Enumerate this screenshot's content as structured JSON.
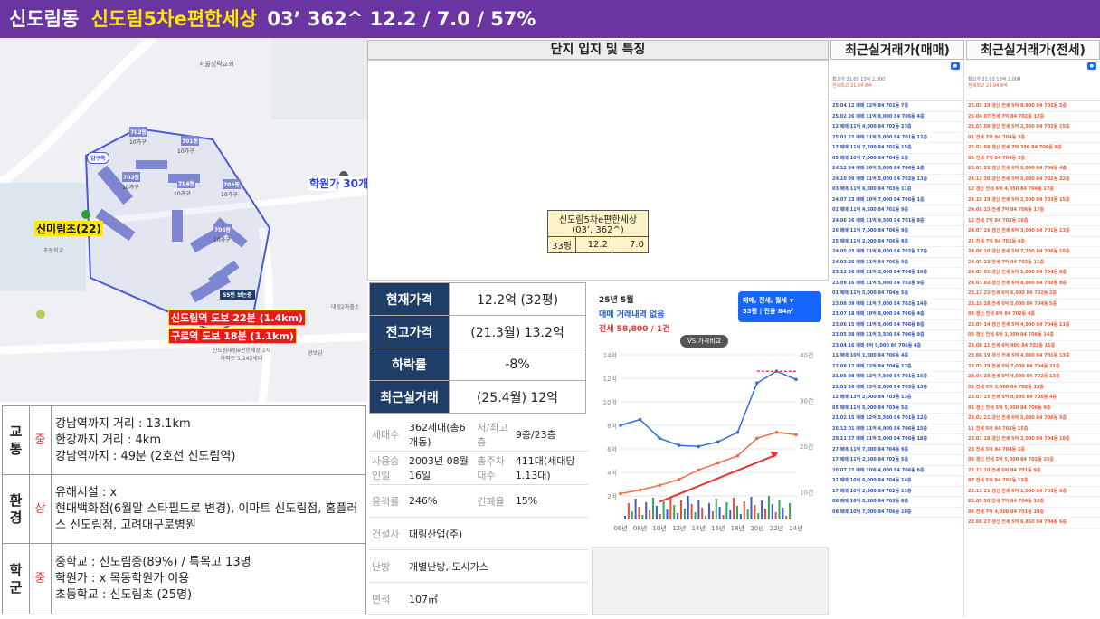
{
  "header": {
    "dong": "신도림동",
    "complex": "신도림5차e편한세상",
    "year_units": "03’ 362^",
    "prices": "12.2 / 7.0 / 57%"
  },
  "map": {
    "labels": {
      "school": "신미림초(22)",
      "academy": "학원가 30개",
      "station1": "신도림역 도보 22분 (1.4km)",
      "station2": "구로역 도보 18분 (1.1km)",
      "bus": "55번 보는중",
      "entrance": "입구쪽",
      "elementary": "초등학교",
      "seoul_church": "서울성락교회",
      "bldgs": [
        {
          "name": "702동",
          "sub": "10가구"
        },
        {
          "name": "701동",
          "sub": "10가구"
        },
        {
          "name": "703동",
          "sub": "10가구"
        },
        {
          "name": "704동",
          "sub": "10가구"
        },
        {
          "name": "705동",
          "sub": "10가구"
        },
        {
          "name": "706동",
          "sub": "10가구"
        }
      ],
      "complex_name": "신도림대림e편한세상 2차아파트 1,242세대",
      "daerim_ps": "대림2파출소",
      "gyeongbo": "경보당"
    }
  },
  "location_section": {
    "title": "단지 입지 및 특징",
    "info_table": {
      "name": "신도림5차e편한세상",
      "sub": "(03’, 362^)",
      "pyeong": "33평",
      "sale": "12.2",
      "jeonse": "7.0"
    }
  },
  "price_table": [
    {
      "key": "현재가격",
      "value": "12.2억 (32평)"
    },
    {
      "key": "전고가격",
      "value": "(21.3월) 13.2억"
    },
    {
      "key": "하락률",
      "value": "-8%"
    },
    {
      "key": "최근실거래",
      "value": "(25.4월) 12억"
    }
  ],
  "details": [
    [
      "세대수",
      "362세대(총6개동)",
      "저/최고층",
      "9층/23층"
    ],
    [
      "사용승인일",
      "2003년 08월 16일",
      "총주차대수",
      "411대(세대당 1.13대)"
    ],
    [
      "용적률",
      "246%",
      "건폐율",
      "15%"
    ],
    [
      "건설사",
      "대림산업(주)",
      "",
      ""
    ],
    [
      "난방",
      "개별난방, 도시가스",
      "",
      ""
    ],
    [
      "면적",
      "107㎡",
      "",
      ""
    ]
  ],
  "chart": {
    "month": "25년 5월",
    "status": "매매 거래내역 없음",
    "jeonse": "전세 58,800 / 1건",
    "tag_line1": "매매, 전세, 월세 ∨",
    "tag_line2": "33평 | 전용 84㎡",
    "vs_label": "VS 가격비교"
  },
  "chart_data": {
    "type": "line",
    "x": [
      "06년",
      "08년",
      "10년",
      "12년",
      "14년",
      "16년",
      "18년",
      "20년",
      "22년",
      "24년"
    ],
    "series": [
      {
        "values": [
          8,
          8.5,
          6.9,
          6.3,
          6.2,
          6.6,
          7.4,
          11.6,
          12.6,
          11.9
        ]
      },
      {
        "values": [
          2.2,
          2.5,
          2.9,
          3.4,
          4.2,
          4.8,
          5.4,
          6.9,
          7.4,
          7.2
        ]
      }
    ],
    "ylim": [
      0,
      14
    ],
    "yticks": [
      "14억",
      "12억",
      "10억",
      "8억",
      "6억",
      "4억",
      "2억"
    ],
    "y2ticks": [
      "40건",
      "30건",
      "20건",
      "10건"
    ],
    "grid": true
  },
  "left_info": [
    {
      "cat": "교통",
      "rating": "중",
      "lines": [
        "강남역까지 거리 : 13.1km",
        "한강까지 거리 : 4km",
        "강남역까지 : 49분 (2호선 신도림역)"
      ]
    },
    {
      "cat": "환경",
      "rating": "상",
      "lines": [
        "유해시설 : x",
        "현대백화점(6월말 스타필드로 변경), 이마트 신도림점, 홈플러스 신도림점, 고려대구로병원"
      ]
    },
    {
      "cat": "학군",
      "rating": "중",
      "lines": [
        "중학교 : 신도림중(89%) / 특목고 13명",
        "학원가 : x 목동학원가 이용",
        "초등학교 : 신도림초 (25명)"
      ]
    }
  ],
  "recent": {
    "sale": {
      "title": "최근실거래가(매매)",
      "peak": "최고가 21.03 13억 2,000",
      "jeonse_peak": "전세최고 21.04 8억",
      "rows": [
        "25.04 12 매매 12억 84 701동 7층",
        "25.02 26 매매 11억 8,000 84 706동 4층",
        "12 매매 11억 4,000 84 702동 23층",
        "25.01 22 매매 11억 5,000 84 701동 12층",
        "17 매매 11억 7,200 84 701동 15층",
        "05 매매 10억 7,000 84 704동 1층",
        "24.12 24 매매 10억 3,000 84 706동 1층",
        "24.10 09 매매 11억 5,000 84 702동 13층",
        "03 매매 11억 6,000 84 703동 11층",
        "24.07 23 매매 10억 7,000 84 706동 1층",
        "02 매매 11억 4,500 84 701동 9층",
        "24.06 26 매매 11억 9,500 84 701동 8층",
        "26 매매 11억 7,000 84 706동 9층",
        "25 매매 11억 2,000 84 706동 8층",
        "24.05 03 매매 11억 8,000 84 702동 17층",
        "24.03 25 매매 11억 84 706동 9층",
        "23.12 26 매매 11억 2,000 84 704동 10층",
        "23.09 16 매매 11억 5,000 84 702동 9층",
        "01 매매 11억 5,000 84 704동 5층",
        "23.08 09 매매 11억 7,000 84 702동 14층",
        "23.07 18 매매 10억 8,000 84 706동 4층",
        "23.06 15 매매 11억 5,000 84 706동 8층",
        "23.05 08 매매 11억 3,500 84 706동 9층",
        "23.04 16 매매 8억 5,000 84 706동 4층",
        "11 매매 10억 1,000 84 706동 4층",
        "22.08 12 매매 12억 84 704동 17층",
        "21.05 08 매매 12억 7,500 84 701동 16층",
        "21.03 26 매매 13억 2,000 84 703동 13층",
        "12 매매 13억 2,000 84 703동 13층",
        "05 매매 11억 5,000 84 703동 5층",
        "21.02 15 매매 12억 5,500 84 701동 12층",
        "20.12 01 매매 11억 4,900 84 706동 15층",
        "20.11 27 매매 11억 3,000 84 706동 18층",
        "27 매매 11억 7,000 84 704동 9층",
        "17 매매 11억 2,500 84 702동 5층",
        "20.07 22 매매 10억 4,000 84 706동 6층",
        "22 매매 10억 6,000 84 704동 14층",
        "17 매매 10억 2,800 84 702동 11층",
        "08 매매 10억 5,300 84 703동 8층",
        "08 매매 10억 7,000 84 706동 10층"
      ]
    },
    "jeonse": {
      "title": "최근실거래가(전세)",
      "peak": "최고가 21.03 13억 2,000",
      "jeonse_peak": "전세최고 21.04 8억",
      "rows": [
        "25.05 10 갱신 전세 5억 8,800 84 702동 5층",
        "25.04 07 전세 7억 84 702동 12층",
        "25.03 08 갱신 전세 5억 2,500 84 702동 15층",
        "01 전세 7억 84 704동 3층",
        "25.02 08 갱신 전세 7억 350 84 706동 8층",
        "05 전세 7억 84 704동 3층",
        "25.01 25 갱신 전세 6억 5,000 84 704동 4층",
        "24.12 30 갱신 전세 5억 5,000 84 702동 22층",
        "12 갱신 전세 6억 4,050 84 704동 17층",
        "24.10 29 갱신 전세 5억 2,500 84 703동 15층",
        "24.08 15 전세 7억 84 706동 17층",
        "12 전세 7억 84 702동 16층",
        "24.07 26 갱신 전세 6억 3,000 84 701동 13층",
        "25 전세 7억 84 701동 4층",
        "24.06 20 갱신 전세 5억 7,750 84 706동 10층",
        "24.05 23 전세 7억 84 703동 11층",
        "24.02 01 갱신 전세 6억 1,000 84 704동 8층",
        "24.01 02 갱신 전세 6억 8,000 84 702동 8층",
        "23.12 23 전세 6억 6,000 84 702동 2층",
        "23.10 28 전세 6억 5,000 84 704동 5층",
        "09 갱신 전세 6억 84 702동 4층",
        "23.09 14 갱신 전세 5억 4,000 84 704동 11층",
        "05 갱신 전세 6억 1,000 84 706동 14층",
        "23.08 11 전세 6억 900 84 702동 11층",
        "23.06 19 갱신 전세 5억 4,000 84 701동 13층",
        "23.05 29 전세 5억 7,000 84 704동 21층",
        "23.04 28 전세 5억 4,000 84 702동 13층",
        "01 전세 5억 3,000 84 702동 13층",
        "23.03 25 전세 5억 8,000 84 706동 4층",
        "01 갱신 전세 5억 5,000 84 706동 9층",
        "23.02 21 갱신 전세 6억 5,000 84 706동 5층",
        "11 전세 5억 84 702동 15층",
        "23.01 28 갱신 전세 5억 2,000 84 704동 10층",
        "23 전세 5억 84 704동 1층",
        "09 갱신 전세 5억 5,000 84 702동 15층",
        "22.12 10 전세 6억 84 701동 9층",
        "07 전세 5억 84 702동 13층",
        "22.11 21 갱신 전세 6억 1,000 84 703동 9층",
        "22.09 30 전세 7억 84 704동 12층",
        "06 전세 7억 4,000 84 701동 10층",
        "22.08 27 갱신 전세 5억 6,850 84 704동 6층"
      ]
    }
  }
}
